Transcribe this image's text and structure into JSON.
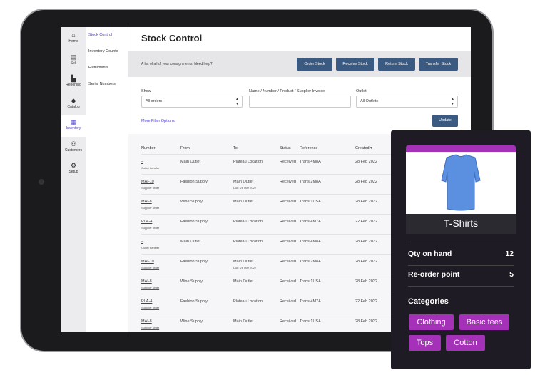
{
  "sidebar": {
    "items": [
      {
        "label": "Home",
        "icon": "home-icon"
      },
      {
        "label": "Sell",
        "icon": "register-icon"
      },
      {
        "label": "Reporting",
        "icon": "chart-icon"
      },
      {
        "label": "Catalog",
        "icon": "tag-icon"
      },
      {
        "label": "Inventory",
        "icon": "boxes-icon",
        "active": true
      },
      {
        "label": "Customers",
        "icon": "people-icon"
      },
      {
        "label": "Setup",
        "icon": "gear-icon"
      }
    ]
  },
  "submenu": {
    "items": [
      "Stock Control",
      "Inventory Counts",
      "Fulfillments",
      "Serial Numbers"
    ]
  },
  "header": {
    "title": "Stock Control",
    "description": "A list of all of your consignments.",
    "help_link": "Need help?"
  },
  "actions": [
    "Order Stock",
    "Receive Stock",
    "Return Stock",
    "Transfer Stock"
  ],
  "filters": {
    "show_label": "Show",
    "show_value": "All orders",
    "search_label": "Name / Number / Product / Supplier Invoice",
    "search_value": "",
    "outlet_label": "Outlet",
    "outlet_value": "All Outlets",
    "more": "More Filter Options",
    "update": "Update"
  },
  "table": {
    "columns": [
      "Number",
      "From",
      "To",
      "Status",
      "Reference",
      "Created ▾"
    ],
    "rows": [
      {
        "number": "–",
        "type": "Outlet transfer",
        "from": "Main Outlet",
        "to": "Plateau Location",
        "due": "",
        "status": "Received",
        "ref": "Trans 4M8A",
        "created": "28 Feb 2022"
      },
      {
        "number": "MAI-10",
        "type": "Supplier order",
        "from": "Fashion Supply",
        "to": "Main Outlet",
        "due": "Due: 26 Mar 2022",
        "status": "Received",
        "ref": "Trans 2M8A",
        "created": "28 Feb 2022"
      },
      {
        "number": "MAI-8",
        "type": "Supplier order",
        "from": "Wine Supply",
        "to": "Main Outlet",
        "due": "",
        "status": "Received",
        "ref": "Trans 1USA",
        "created": "28 Feb 2022"
      },
      {
        "number": "PLA-4",
        "type": "Supplier order",
        "from": "Fashion Supply",
        "to": "Plateau Location",
        "due": "",
        "status": "Received",
        "ref": "Trans 4M7A",
        "created": "22 Feb 2022"
      },
      {
        "number": "–",
        "type": "Outlet transfer",
        "from": "Main Outlet",
        "to": "Plateau Location",
        "due": "",
        "status": "Received",
        "ref": "Trans 4M8A",
        "created": "28 Feb 2022"
      },
      {
        "number": "MAI-10",
        "type": "Supplier order",
        "from": "Fashion Supply",
        "to": "Main Outlet",
        "due": "Due: 26 Mar 2022",
        "status": "Received",
        "ref": "Trans 2M8A",
        "created": "28 Feb 2022"
      },
      {
        "number": "MAI-8",
        "type": "Supplier order",
        "from": "Wine Supply",
        "to": "Main Outlet",
        "due": "",
        "status": "Received",
        "ref": "Trans 1USA",
        "created": "28 Feb 2022"
      },
      {
        "number": "PLA-4",
        "type": "Supplier order",
        "from": "Fashion Supply",
        "to": "Plateau Location",
        "due": "",
        "status": "Received",
        "ref": "Trans 4M7A",
        "created": "22 Feb 2022"
      },
      {
        "number": "MAI-8",
        "type": "Supplier order",
        "from": "Wine Supply",
        "to": "Main Outlet",
        "due": "",
        "status": "Received",
        "ref": "Trans 1USA",
        "created": "28 Feb 2022"
      }
    ]
  },
  "card": {
    "product": "T-Shirts",
    "qty_label": "Qty on hand",
    "qty": "12",
    "reorder_label": "Re-order point",
    "reorder": "5",
    "categories_label": "Categories",
    "categories": [
      "Clothing",
      "Basic tees",
      "Tops",
      "Cotton"
    ],
    "accent": "#a431b8"
  }
}
